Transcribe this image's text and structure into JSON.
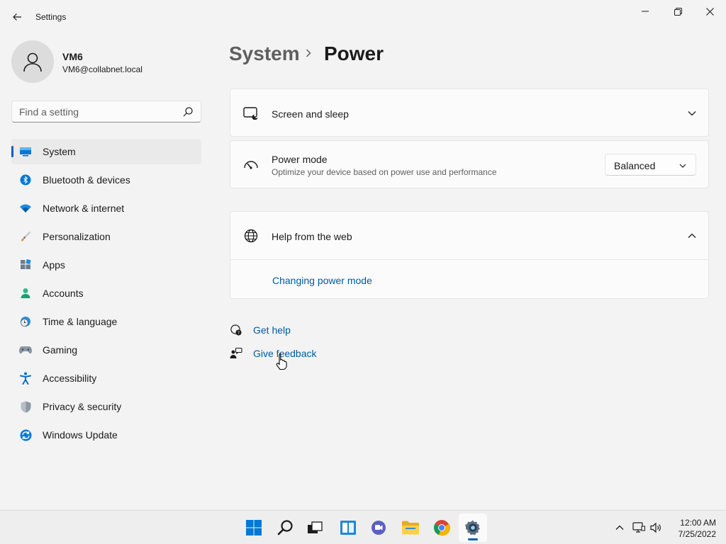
{
  "window": {
    "title": "Settings",
    "controls": {
      "minimize": "minimize-icon",
      "maximize": "restore-icon",
      "close": "close-icon"
    }
  },
  "profile": {
    "name": "VM6",
    "email": "VM6@collabnet.local"
  },
  "search": {
    "placeholder": "Find a setting"
  },
  "nav": {
    "items": [
      {
        "label": "System",
        "icon": "system-icon",
        "active": true
      },
      {
        "label": "Bluetooth & devices",
        "icon": "bluetooth-icon"
      },
      {
        "label": "Network & internet",
        "icon": "wifi-icon"
      },
      {
        "label": "Personalization",
        "icon": "brush-icon"
      },
      {
        "label": "Apps",
        "icon": "apps-icon"
      },
      {
        "label": "Accounts",
        "icon": "accounts-icon"
      },
      {
        "label": "Time & language",
        "icon": "clock-globe-icon"
      },
      {
        "label": "Gaming",
        "icon": "gamepad-icon"
      },
      {
        "label": "Accessibility",
        "icon": "accessibility-icon"
      },
      {
        "label": "Privacy & security",
        "icon": "shield-icon"
      },
      {
        "label": "Windows Update",
        "icon": "update-icon"
      }
    ]
  },
  "header": {
    "parent": "System",
    "current": "Power"
  },
  "cards": {
    "screen_sleep": {
      "title": "Screen and sleep"
    },
    "power_mode": {
      "title": "Power mode",
      "subtitle": "Optimize your device based on power use and performance",
      "value": "Balanced"
    },
    "help": {
      "title": "Help from the web",
      "link": "Changing power mode"
    }
  },
  "footer": {
    "get_help": "Get help",
    "give_feedback": "Give feedback"
  },
  "taskbar": {
    "apps": [
      "start-icon",
      "search-icon",
      "task-view-icon",
      "widgets-icon",
      "teams-chat-icon",
      "file-explorer-icon",
      "chrome-icon",
      "settings-icon"
    ],
    "time": "12:00 AM",
    "date": "7/25/2022"
  },
  "colors": {
    "accent": "#005fb8",
    "link": "#005a9e",
    "background": "#f3f3f3",
    "card": "#fbfbfb"
  }
}
